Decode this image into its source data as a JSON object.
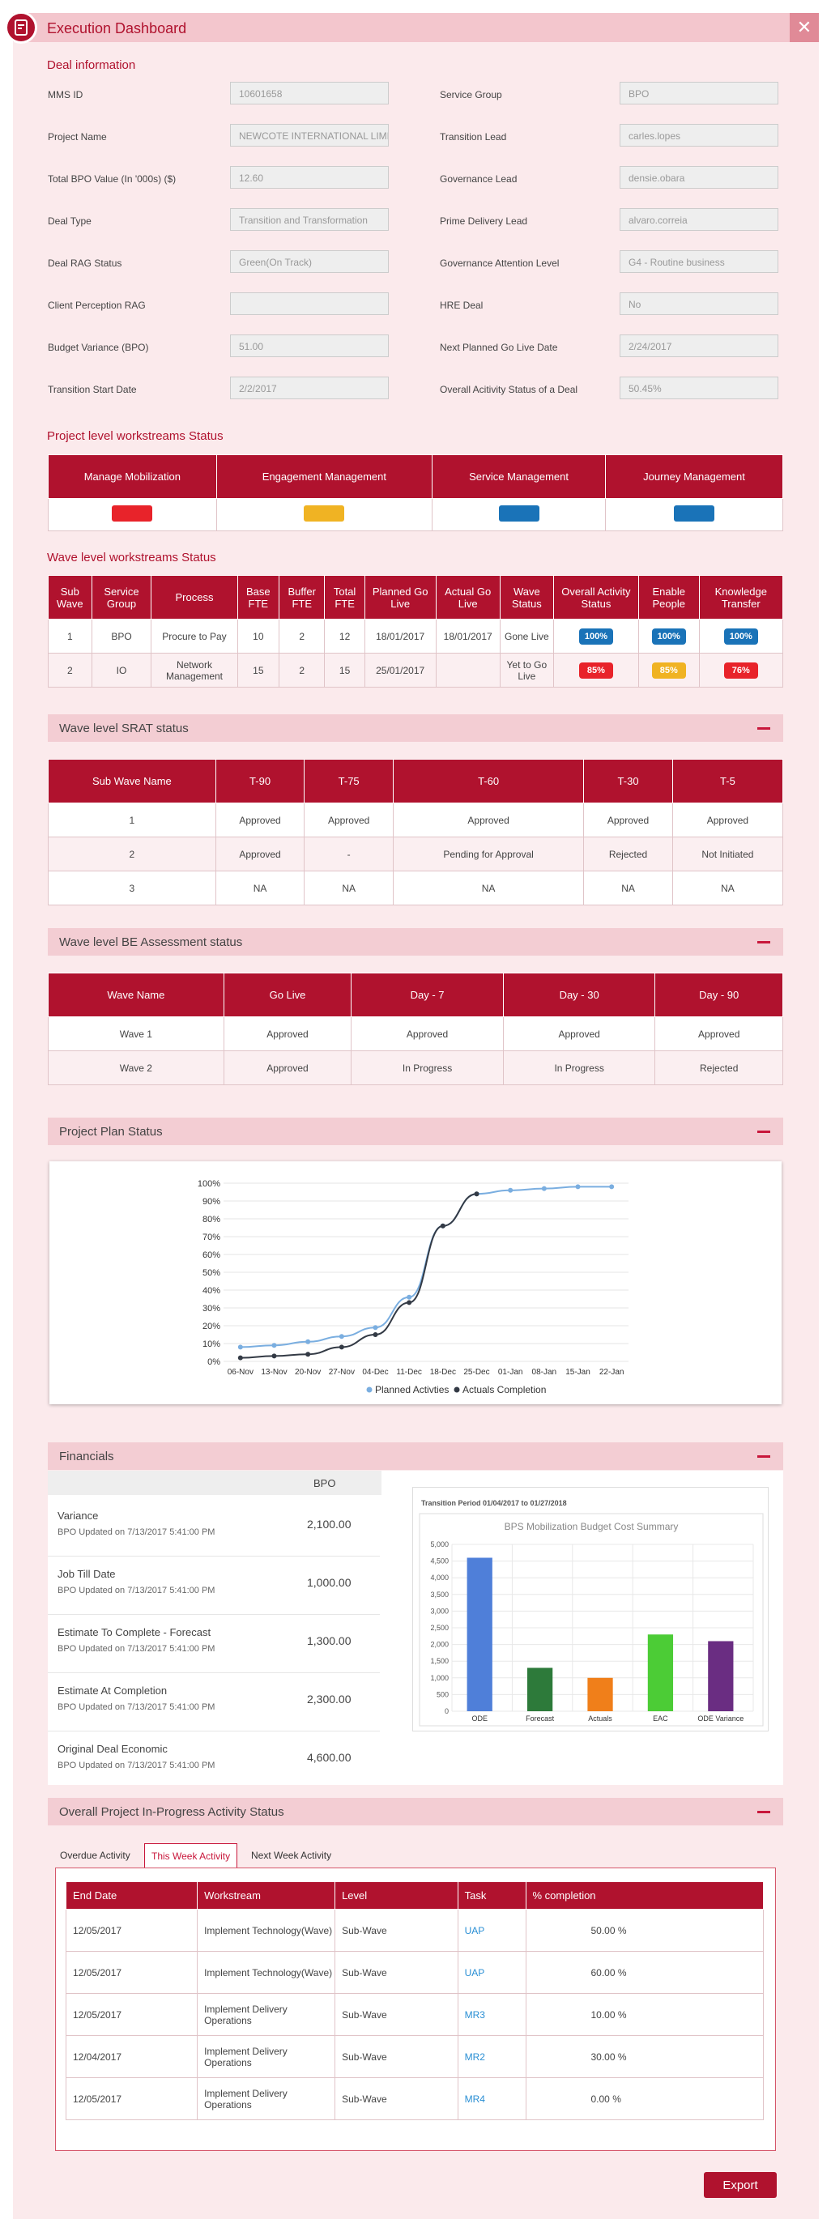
{
  "header": {
    "title": "Execution Dashboard",
    "close_label": "✕"
  },
  "deal": {
    "section_title": "Deal information",
    "left": [
      {
        "label": "MMS ID",
        "value": "10601658"
      },
      {
        "label": "Project Name",
        "value": "NEWCOTE INTERNATIONAL LIMITE"
      },
      {
        "label": "Total BPO Value (In '000s) ($)",
        "value": "12.60"
      },
      {
        "label": "Deal Type",
        "value": "Transition and Transformation"
      },
      {
        "label": "Deal RAG Status",
        "value": "Green(On Track)"
      },
      {
        "label": "Client Perception RAG",
        "value": ""
      },
      {
        "label": "Budget Variance (BPO)",
        "value": "51.00"
      },
      {
        "label": "Transition Start Date",
        "value": "2/2/2017"
      }
    ],
    "right": [
      {
        "label": "Service Group",
        "value": "BPO"
      },
      {
        "label": "Transition Lead",
        "value": "carles.lopes"
      },
      {
        "label": "Governance Lead",
        "value": "densie.obara"
      },
      {
        "label": "Prime Delivery Lead",
        "value": "alvaro.correia"
      },
      {
        "label": "Governance Attention Level",
        "value": "G4 - Routine business"
      },
      {
        "label": "HRE Deal",
        "value": "No"
      },
      {
        "label": "Next Planned Go Live Date",
        "value": "2/24/2017"
      },
      {
        "label": "Overall Acitivity Status of a Deal",
        "value": "50.45%"
      }
    ]
  },
  "project_ws": {
    "title": "Project level workstreams Status",
    "headers": [
      "Manage Mobilization",
      "Engagement Management",
      "Service Management",
      "Journey Management"
    ],
    "colors": [
      "#e8232a",
      "#f0b323",
      "#1a73b8",
      "#1a73b8"
    ]
  },
  "wave_ws": {
    "title": "Wave level workstreams Status",
    "headers": [
      "Sub Wave",
      "Service Group",
      "Process",
      "Base FTE",
      "Buffer FTE",
      "Total FTE",
      "Planned Go Live",
      "Actual Go Live",
      "Wave Status",
      "Overall Activity Status",
      "Enable People",
      "Knowledge Transfer"
    ],
    "rows": [
      {
        "cells": [
          "1",
          "BPO",
          "Procure to Pay",
          "10",
          "2",
          "12",
          "18/01/2017",
          "18/01/2017",
          "Gone Live"
        ],
        "pills": [
          {
            "text": "100%",
            "color": "#1a73b8"
          },
          {
            "text": "100%",
            "color": "#1a73b8"
          },
          {
            "text": "100%",
            "color": "#1a73b8"
          }
        ]
      },
      {
        "cells": [
          "2",
          "IO",
          "Network Management",
          "15",
          "2",
          "15",
          "25/01/2017",
          "",
          "Yet to Go Live"
        ],
        "pills": [
          {
            "text": "85%",
            "color": "#e8232a"
          },
          {
            "text": "85%",
            "color": "#f0b323"
          },
          {
            "text": "76%",
            "color": "#e8232a"
          }
        ]
      }
    ]
  },
  "srat": {
    "title": "Wave level SRAT status",
    "headers": [
      "Sub Wave Name",
      "T-90",
      "T-75",
      "T-60",
      "T-30",
      "T-5"
    ],
    "rows": [
      [
        "1",
        "Approved",
        "Approved",
        "Approved",
        "Approved",
        "Approved"
      ],
      [
        "2",
        "Approved",
        "-",
        "Pending for Approval",
        "Rejected",
        "Not Initiated"
      ],
      [
        "3",
        "NA",
        "NA",
        "NA",
        "NA",
        "NA"
      ]
    ]
  },
  "be": {
    "title": "Wave level BE Assessment status",
    "headers": [
      "Wave Name",
      "Go Live",
      "Day - 7",
      "Day - 30",
      "Day - 90"
    ],
    "rows": [
      [
        "Wave 1",
        "Approved",
        "Approved",
        "Approved",
        "Approved"
      ],
      [
        "Wave 2",
        "Approved",
        "In Progress",
        "In Progress",
        "Rejected"
      ]
    ]
  },
  "plan": {
    "title": "Project Plan Status"
  },
  "chart_data": [
    {
      "type": "line",
      "x": [
        "06-Nov",
        "13-Nov",
        "20-Nov",
        "27-Nov",
        "04-Dec",
        "11-Dec",
        "18-Dec",
        "25-Dec",
        "01-Jan",
        "08-Jan",
        "15-Jan",
        "22-Jan"
      ],
      "yticks": [
        "0%",
        "10%",
        "20%",
        "30%",
        "40%",
        "50%",
        "60%",
        "70%",
        "80%",
        "90%",
        "100%"
      ],
      "ylim": [
        0,
        100
      ],
      "series": [
        {
          "name": "Planned Activties",
          "color": "#7aaee0",
          "points": [
            [
              0,
              8
            ],
            [
              1,
              9
            ],
            [
              2,
              11
            ],
            [
              3,
              14
            ],
            [
              4,
              19
            ],
            [
              5,
              36
            ],
            [
              6,
              76
            ],
            [
              7,
              94
            ],
            [
              8,
              96
            ],
            [
              9,
              97
            ],
            [
              10,
              98
            ],
            [
              11,
              98
            ]
          ]
        },
        {
          "name": "Actuals Completion",
          "color": "#333a45",
          "points": [
            [
              0,
              2
            ],
            [
              1,
              3
            ],
            [
              2,
              4
            ],
            [
              3,
              8
            ],
            [
              4,
              15
            ],
            [
              5,
              33
            ],
            [
              6,
              76
            ],
            [
              7,
              94
            ]
          ]
        }
      ]
    },
    {
      "type": "bar",
      "title": "BPS Mobilization Budget Cost Summary",
      "subtitle": "Transition Period 01/04/2017 to 01/27/2018",
      "categories": [
        "ODE",
        "Forecast",
        "Actuals",
        "EAC",
        "ODE Variance"
      ],
      "values": [
        4600,
        1300,
        1000,
        2300,
        2100
      ],
      "colors": [
        "#4f7fd9",
        "#2d7a3a",
        "#f07f1a",
        "#4ccc36",
        "#6a2d82"
      ],
      "yticks": [
        "0",
        "500",
        "1,000",
        "1,500",
        "2,000",
        "2,500",
        "3,000",
        "3,500",
        "4,000",
        "4,500",
        "5,000"
      ],
      "ylim": [
        0,
        5000
      ]
    }
  ],
  "financials": {
    "title": "Financials",
    "col_header": "BPO",
    "rows": [
      {
        "name": "Variance",
        "sub": "BPO Updated on 7/13/2017 5:41:00 PM",
        "value": "2,100.00"
      },
      {
        "name": "Job Till Date",
        "sub": "BPO Updated on 7/13/2017 5:41:00 PM",
        "value": "1,000.00"
      },
      {
        "name": "Estimate To Complete - Forecast",
        "sub": "BPO Updated on 7/13/2017 5:41:00 PM",
        "value": "1,300.00"
      },
      {
        "name": "Estimate At Completion",
        "sub": "BPO Updated on 7/13/2017 5:41:00 PM",
        "value": "2,300.00"
      },
      {
        "name": "Original Deal Economic",
        "sub": "BPO Updated on 7/13/2017 5:41:00 PM",
        "value": "4,600.00"
      }
    ]
  },
  "activity": {
    "title": "Overall Project In-Progress Activity Status",
    "tabs": [
      "Overdue Activity",
      "This Week Activity",
      "Next Week Activity"
    ],
    "headers": [
      "End Date",
      "Workstream",
      "Level",
      "Task",
      "% completion"
    ],
    "rows": [
      [
        "12/05/2017",
        "Implement Technology(Wave)",
        "Sub-Wave",
        "UAP",
        "50.00 %"
      ],
      [
        "12/05/2017",
        "Implement Technology(Wave)",
        "Sub-Wave",
        "UAP",
        "60.00 %"
      ],
      [
        "12/05/2017",
        "Implement Delivery Operations",
        "Sub-Wave",
        "MR3",
        "10.00 %"
      ],
      [
        "12/04/2017",
        "Implement Delivery Operations",
        "Sub-Wave",
        "MR2",
        "30.00 %"
      ],
      [
        "12/05/2017",
        "Implement Delivery Operations",
        "Sub-Wave",
        "MR4",
        "0.00 %"
      ]
    ]
  },
  "export_label": "Export"
}
